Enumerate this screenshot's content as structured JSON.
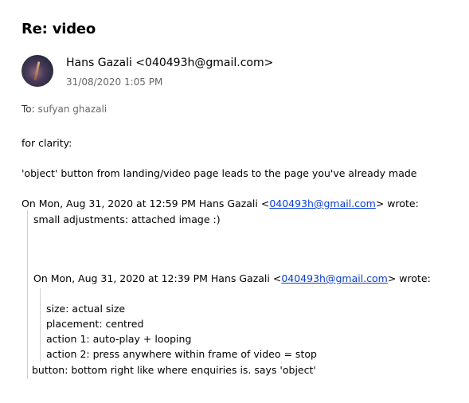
{
  "email": {
    "subject": "Re: video",
    "sender": "Hans Gazali <040493h@gmail.com>",
    "date": "31/08/2020 1:05 PM",
    "to_label": "To:",
    "to_name": "sufyan ghazali"
  },
  "body": {
    "line1": "for clarity:",
    "line2": "'object' button from landing/video page leads to the page you've already made",
    "quote1": {
      "prefix": "On Mon, Aug 31, 2020 at 12:59 PM Hans Gazali <",
      "email": "040493h@gmail.com",
      "suffix": "> wrote:",
      "text": "small adjustments: attached image :)"
    },
    "quote2": {
      "prefix": "On Mon, Aug 31, 2020 at 12:39 PM Hans Gazali <",
      "email": "040493h@gmail.com",
      "suffix": "> wrote:",
      "items": [
        "size: actual size",
        "placement: centred",
        "action 1: auto-play + looping",
        "action 2: press anywhere within frame of video = stop"
      ]
    },
    "line_last": "button: bottom right like where enquiries is. says 'object'"
  }
}
